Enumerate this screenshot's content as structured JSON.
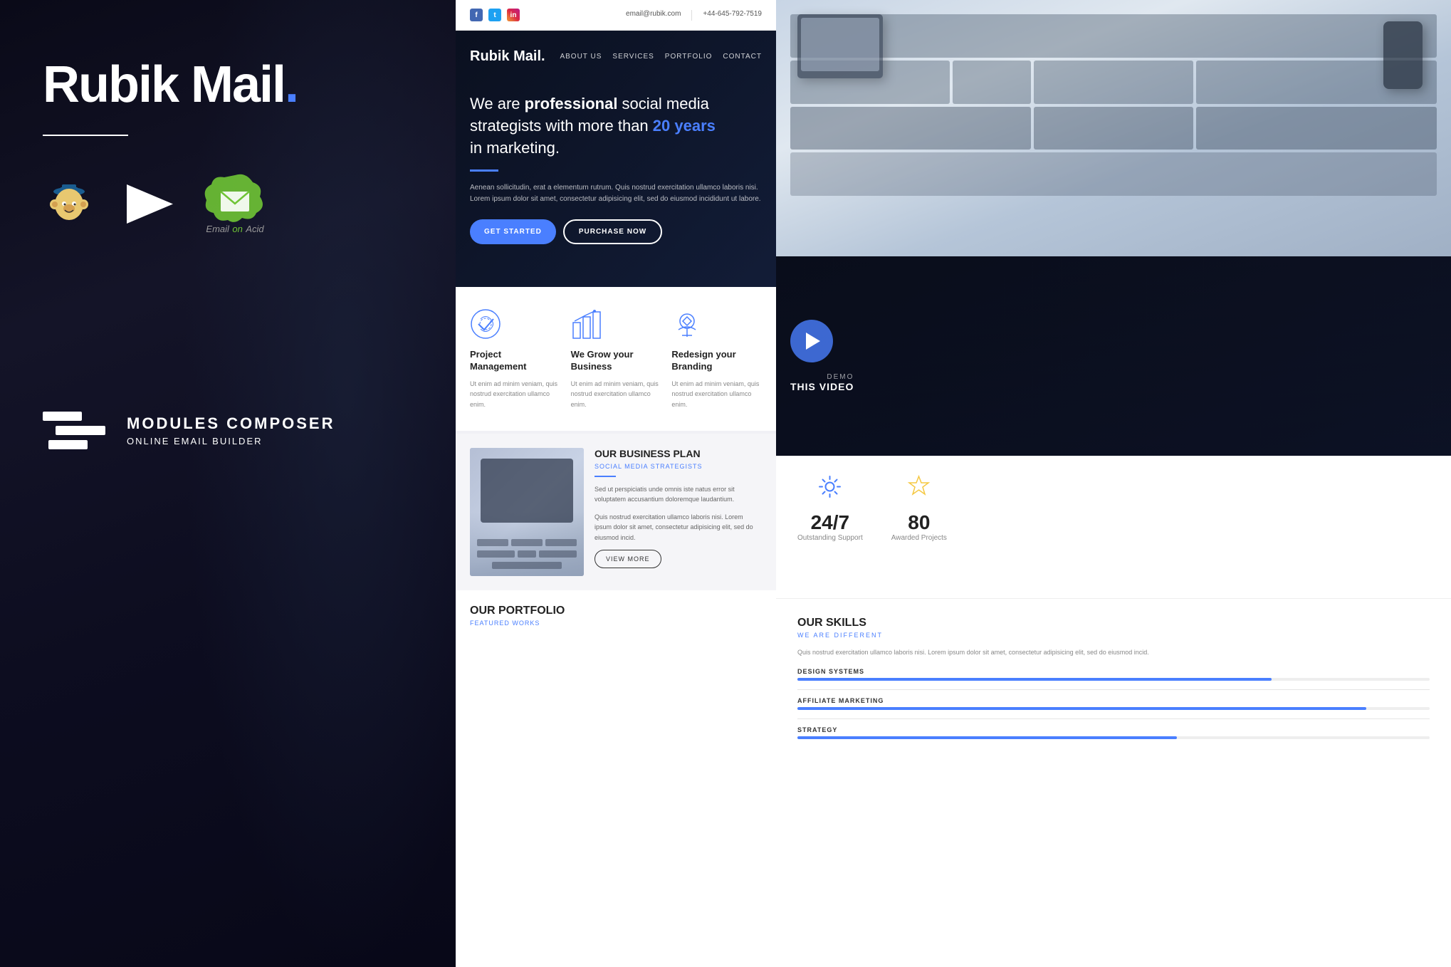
{
  "brand": {
    "name": "Rubik Mail",
    "dot_color": "#4a7fff",
    "tagline": ""
  },
  "left_panel": {
    "title_part1": "Rubik Mail",
    "title_dot": ".",
    "logos": [
      {
        "name": "Mailchimp",
        "type": "monkey"
      },
      {
        "name": "Campaign Monitor",
        "type": "envelope"
      },
      {
        "name": "Email on Acid",
        "type": "splash"
      }
    ],
    "modules_title": "MODULES COMPOSER",
    "modules_subtitle": "ONLINE EMAIL BUILDER"
  },
  "email_preview": {
    "topbar": {
      "email": "email@rubik.com",
      "phone": "+44-645-792-7519"
    },
    "nav": {
      "logo": "Rubik Mail.",
      "links": [
        "ABOUT US",
        "SERVICES",
        "PORTFOLIO",
        "CONTACT"
      ]
    },
    "hero": {
      "headline_plain": "We are",
      "headline_bold": "professional",
      "headline_end": "social media strategists with more than",
      "years": "20 years",
      "headline_last": "in marketing.",
      "description": "Aenean sollicitudin, erat a elementum rutrum. Quis nostrud exercitation ullamco laboris nisi. Lorem ipsum dolor sit amet, consectetur adipisicing elit, sed do eiusmod incididunt ut labore.",
      "btn_primary": "GET STARTED",
      "btn_secondary": "PURCHASE NOW"
    },
    "features": [
      {
        "title": "Project Management",
        "desc": "Ut enim ad minim veniam, quis nostrud exercitation ullamco enim."
      },
      {
        "title": "We Grow your Business",
        "desc": "Ut enim ad minim veniam, quis nostrud exercitation ullamco enim."
      },
      {
        "title": "Redesign your Branding",
        "desc": "Ut enim ad minim veniam, quis nostrud exercitation ullamco enim."
      }
    ],
    "business_plan": {
      "title": "OUR BUSINESS PLAN",
      "subtitle": "SOCIAL MEDIA STRATEGISTS",
      "desc1": "Sed ut perspiciatis unde omnis iste natus error sit voluptatem accusantium doloremque laudantium.",
      "desc2": "Quis nostrud exercitation ullamco laboris nisi. Lorem ipsum dolor sit amet, consectetur adipisicing elit, sed do eiusmod incid.",
      "btn": "VIEW MORE"
    },
    "portfolio": {
      "title": "OUR PORTFOLIO",
      "subtitle": "FEATURED WORKS"
    }
  },
  "side_panels": {
    "video": {
      "demo_label": "DEMO",
      "title": "THIS VIDEO"
    },
    "stats": [
      {
        "number": "24/7",
        "label": "Outstanding Support",
        "icon": "gear"
      },
      {
        "number": "80",
        "label": "Awarded Projects",
        "icon": "star"
      }
    ],
    "skills": {
      "title": "OUR SKILLS",
      "subtitle": "WE ARE DIFFERENT",
      "desc": "Quis nostrud exercitation ullamco laboris nisi. Lorem ipsum dolor sit amet, consectetur adipisicing elit, sed do eiusmod incid.",
      "items": [
        {
          "label": "DESIGN SYSTEMS",
          "percent": 75
        },
        {
          "label": "AFFILIATE MARKETING",
          "percent": 90
        },
        {
          "label": "STRATEGY",
          "percent": 60
        }
      ]
    }
  }
}
